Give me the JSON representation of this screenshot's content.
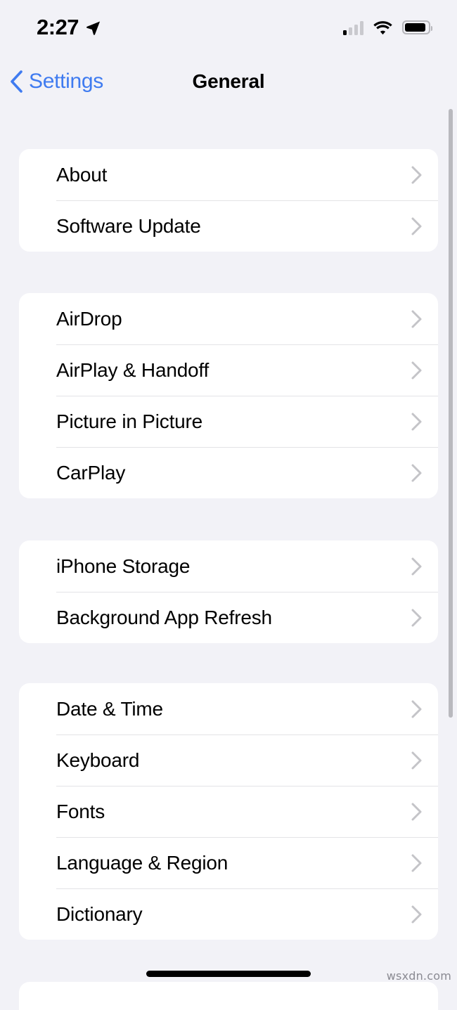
{
  "status_bar": {
    "time": "2:27",
    "location_icon": "location-arrow-icon",
    "cellular_icon": "cellular-signal-icon",
    "cellular_bars_filled": 1,
    "cellular_bars_total": 4,
    "wifi_icon": "wifi-icon",
    "battery_icon": "battery-icon",
    "battery_level_percent": 92
  },
  "nav": {
    "back_label": "Settings",
    "back_icon": "chevron-left-icon",
    "title": "General"
  },
  "colors": {
    "accent_blue": "#3f7bf0",
    "background": "#f2f2f7",
    "card": "#ffffff",
    "separator": "#e3e3e6",
    "chevron": "#c4c4c8"
  },
  "groups": [
    {
      "id": "group-system",
      "rows": [
        {
          "label": "About",
          "accessory": "chevron-right-icon"
        },
        {
          "label": "Software Update",
          "accessory": "chevron-right-icon"
        }
      ]
    },
    {
      "id": "group-connectivity",
      "rows": [
        {
          "label": "AirDrop",
          "accessory": "chevron-right-icon"
        },
        {
          "label": "AirPlay & Handoff",
          "accessory": "chevron-right-icon"
        },
        {
          "label": "Picture in Picture",
          "accessory": "chevron-right-icon"
        },
        {
          "label": "CarPlay",
          "accessory": "chevron-right-icon"
        }
      ]
    },
    {
      "id": "group-storage",
      "rows": [
        {
          "label": "iPhone Storage",
          "accessory": "chevron-right-icon"
        },
        {
          "label": "Background App Refresh",
          "accessory": "chevron-right-icon"
        }
      ]
    },
    {
      "id": "group-localization",
      "rows": [
        {
          "label": "Date & Time",
          "accessory": "chevron-right-icon"
        },
        {
          "label": "Keyboard",
          "accessory": "chevron-right-icon"
        },
        {
          "label": "Fonts",
          "accessory": "chevron-right-icon"
        },
        {
          "label": "Language & Region",
          "accessory": "chevron-right-icon"
        },
        {
          "label": "Dictionary",
          "accessory": "chevron-right-icon"
        }
      ]
    }
  ],
  "scrollbar": {
    "name": "vertical-scrollbar"
  },
  "home_indicator": {
    "name": "home-indicator"
  },
  "watermark": {
    "text": "wsxdn.com"
  }
}
